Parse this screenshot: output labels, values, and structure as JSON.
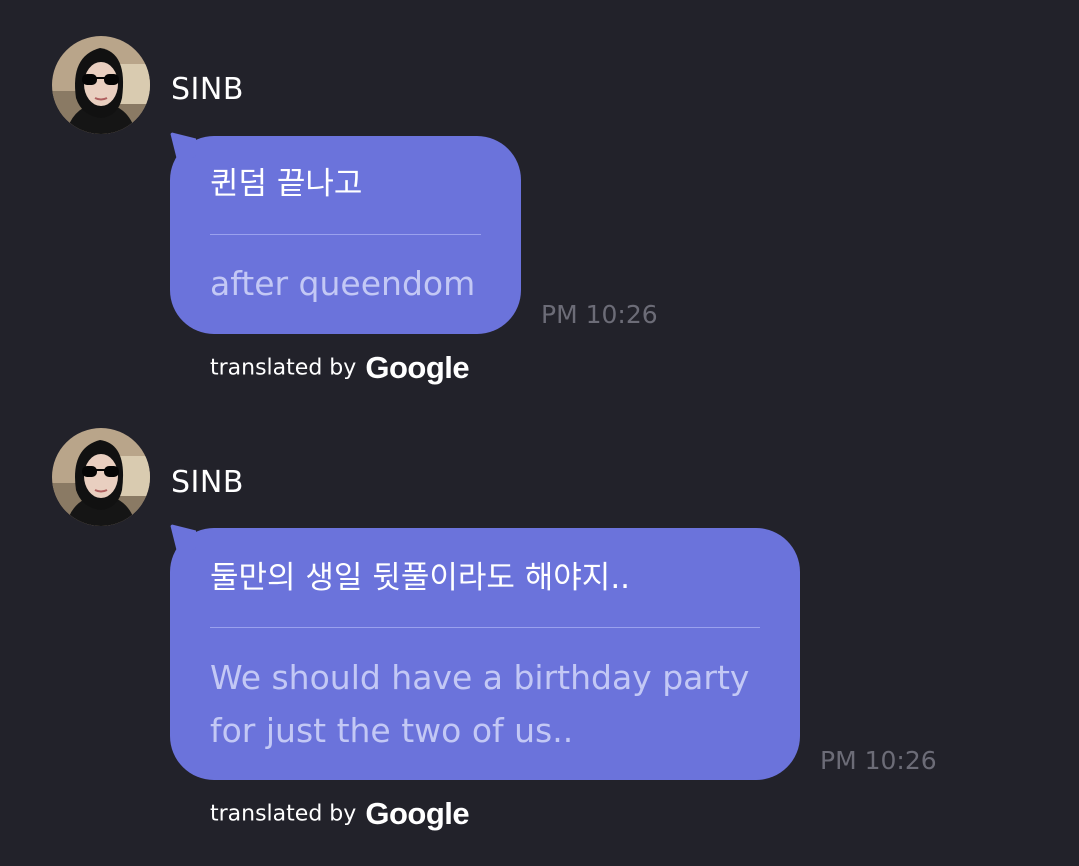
{
  "messages": [
    {
      "sender": "SINB",
      "avatar": "profile-photo-avatar",
      "original": "퀸덤 끝나고",
      "translated": "after queendom",
      "time": "PM 10:26",
      "attribution_prefix": "translated by",
      "attribution_brand": "Google"
    },
    {
      "sender": "SINB",
      "avatar": "profile-photo-avatar",
      "original": "둘만의 생일 뒷풀이라도 해야지..",
      "translated": "We should have a birthday party for just the two of us..",
      "time": "PM 10:26",
      "attribution_prefix": "translated by",
      "attribution_brand": "Google"
    }
  ],
  "colors": {
    "background": "#22222a",
    "bubble": "#6b73db",
    "translated_text": "#c3c8f5",
    "timestamp": "#6c6c77"
  }
}
